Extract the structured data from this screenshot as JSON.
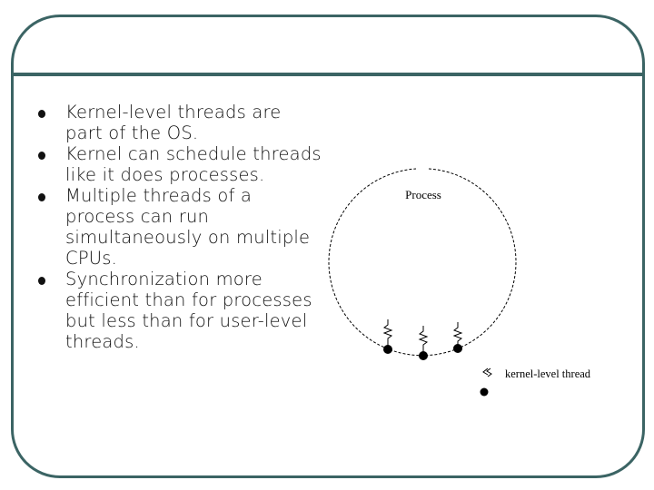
{
  "slide": {
    "title": "",
    "bullets": [
      {
        "text": "Kernel-level threads are part of the OS."
      },
      {
        "text": "Kernel can schedule threads like it does processes."
      },
      {
        "text": "Multiple threads of a process can run simultaneously on multiple CPUs."
      },
      {
        "text": "Synchronization more efficient than for processes but less than for user-level threads."
      }
    ],
    "diagram": {
      "process_label": "Process",
      "legend_label": "kernel-level thread",
      "thread_count": 3
    },
    "colors": {
      "frame": "#3b6464",
      "text": "#111111"
    }
  }
}
